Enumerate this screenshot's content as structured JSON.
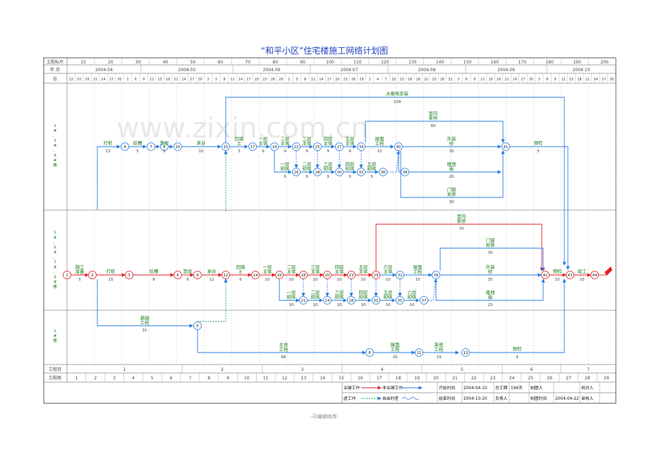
{
  "title": "“和平小区”住宅楼施工网络计划图",
  "watermark": "www.zixin.com.cn",
  "footer": "-可编辑修改-",
  "header": {
    "row1_label": "工程标尺",
    "row2_label": "年  月",
    "row3_label": "日",
    "scale_ticks": [
      "10",
      "20",
      "30",
      "40",
      "50",
      "60",
      "70",
      "80",
      "90",
      "100",
      "110",
      "120",
      "130",
      "140",
      "150",
      "160",
      "170",
      "180",
      "190",
      "200"
    ],
    "months": [
      "2004.04",
      "2004.05",
      "2004.06",
      "2004.07",
      "2004.08",
      "2004.09",
      "2004.10"
    ],
    "days": [
      "12",
      "15",
      "18",
      "21",
      "24",
      "27",
      "30",
      "3",
      "6",
      "9",
      "12",
      "15",
      "18",
      "21",
      "24",
      "27",
      "30",
      "2",
      "5",
      "8",
      "11",
      "14",
      "17",
      "20",
      "23",
      "26",
      "29",
      "2",
      "5",
      "8",
      "11",
      "14",
      "17",
      "20",
      "23",
      "26",
      "29",
      "1",
      "4",
      "7",
      "10",
      "13",
      "16",
      "19",
      "22",
      "25",
      "28",
      "31",
      "3",
      "6",
      "9",
      "12",
      "15",
      "18",
      "21",
      "24",
      "27",
      "30",
      "3",
      "6",
      "9",
      "12",
      "15",
      "18",
      "21",
      "24",
      "27",
      "30"
    ]
  },
  "rows": [
    {
      "label": "2\n#\n、\n3\n#\n、\n4\n#\n楼"
    },
    {
      "label": "5\n#\n、\n6\n#\n、\n7\n#\n、\n8\n#\n楼"
    },
    {
      "label": "1\n#\n楼"
    }
  ],
  "footer_table": {
    "month_label": "工程月",
    "week_label": "工程周",
    "months": [
      "1",
      "2",
      "3",
      "4",
      "5",
      "6",
      "7"
    ],
    "weeks": [
      "1",
      "2",
      "3",
      "4",
      "5",
      "6",
      "7",
      "8",
      "9",
      "10",
      "11",
      "12",
      "13",
      "14",
      "15",
      "16",
      "17",
      "18",
      "19",
      "20",
      "21",
      "22",
      "23",
      "24",
      "25",
      "26",
      "27",
      "28",
      "29"
    ]
  },
  "legend": {
    "critical": "关键工作",
    "noncritical": "非关键工作",
    "dummy": "虚工作",
    "float": "自由时差",
    "start_label": "开始时间",
    "start_value": "2004-04-10",
    "end_label": "结束时间",
    "end_value": "2004-10-20",
    "total_label": "总工期",
    "total_value": "194天",
    "owner_label": "负责人",
    "drawer_label": "制图人",
    "drawtime_label": "制图时间",
    "drawtime_value": "2004-04-22",
    "check_label": "校对人",
    "review_label": "审核人"
  },
  "activities": {
    "top": [
      {
        "name": "打桩",
        "dur": "13"
      },
      {
        "name": "挖槽",
        "dur": "5"
      },
      {
        "name": "垫层",
        "dur": "5"
      },
      {
        "name": "承台",
        "dur": "10"
      },
      {
        "name": "回填土",
        "dur": "5"
      },
      {
        "name": "一层主体",
        "dur": "9"
      },
      {
        "name": "二层主体",
        "dur": "9"
      },
      {
        "name": "三层主体",
        "dur": "9"
      },
      {
        "name": "四层主体",
        "dur": "9"
      },
      {
        "name": "五层主体",
        "dur": "9"
      },
      {
        "name": "屋面工程",
        "dur": "15"
      },
      {
        "name": "水暖电安装",
        "dur": "109"
      },
      {
        "name": "室内装修",
        "dur": "60"
      },
      {
        "name": "外装修",
        "dur": "35"
      },
      {
        "name": "预检",
        "dur": "5"
      },
      {
        "name": "楼地面",
        "dur": "20"
      },
      {
        "name": "门窗安装",
        "dur": "30"
      },
      {
        "name": "一层砌体",
        "dur": "9"
      },
      {
        "name": "二层砌体",
        "dur": "9"
      },
      {
        "name": "三层砌体",
        "dur": "9"
      },
      {
        "name": "四层砌体",
        "dur": "9"
      },
      {
        "name": "五层砌体",
        "dur": "9"
      }
    ],
    "mid": [
      {
        "name": "施工准备",
        "dur": "5"
      },
      {
        "name": "打桩",
        "dur": "15"
      },
      {
        "name": "挖槽",
        "dur": "8"
      },
      {
        "name": "垫层",
        "dur": "8"
      },
      {
        "name": "承台",
        "dur": "12"
      },
      {
        "name": "回填土",
        "dur": "6"
      },
      {
        "name": "一层主体",
        "dur": "10"
      },
      {
        "name": "二层主体",
        "dur": "10"
      },
      {
        "name": "三层主体",
        "dur": "10"
      },
      {
        "name": "四层主体",
        "dur": "10"
      },
      {
        "name": "五层主体",
        "dur": "10"
      },
      {
        "name": "六层主体",
        "dur": "10"
      },
      {
        "name": "屋面工程",
        "dur": "15"
      },
      {
        "name": "室内装修",
        "dur": "70"
      },
      {
        "name": "门窗安装",
        "dur": "30"
      },
      {
        "name": "外装修",
        "dur": "35"
      },
      {
        "name": "楼地面",
        "dur": "25"
      },
      {
        "name": "预检",
        "dur": "10"
      },
      {
        "name": "竣工",
        "dur": "10"
      },
      {
        "name": "一层砌体",
        "dur": "10"
      },
      {
        "name": "二层砌体",
        "dur": "10"
      },
      {
        "name": "三层砌体",
        "dur": "10"
      },
      {
        "name": "四层砌体",
        "dur": "10"
      },
      {
        "name": "五层砌体",
        "dur": "10"
      },
      {
        "name": "六层砌体",
        "dur": "10"
      }
    ],
    "bot": [
      {
        "name": "基础工程",
        "dur": "31"
      },
      {
        "name": "主体工程",
        "dur": "66"
      },
      {
        "name": "屋面工程",
        "dur": "20"
      },
      {
        "name": "装修工程",
        "dur": "19"
      },
      {
        "name": "预检",
        "dur": "4"
      }
    ]
  },
  "nodes": {
    "top": [
      "4",
      "7",
      "8",
      "10",
      "15",
      "17",
      "19",
      "22",
      "25",
      "27",
      "34",
      "40",
      "41",
      "26",
      "28",
      "30",
      "33",
      "36",
      "38"
    ],
    "mid": [
      "1",
      "2",
      "3",
      "6",
      "9",
      "12",
      "14",
      "16",
      "18",
      "20",
      "23",
      "29",
      "32",
      "39",
      "42",
      "43",
      "44",
      "21",
      "24",
      "28",
      "31",
      "35",
      "37"
    ],
    "bot": [
      "5",
      "8",
      "11",
      "13"
    ]
  },
  "colors": {
    "critical": "#e02020",
    "noncritical": "#2a7de1",
    "label": "#1a7a1a",
    "title": "#1f3fbf"
  }
}
